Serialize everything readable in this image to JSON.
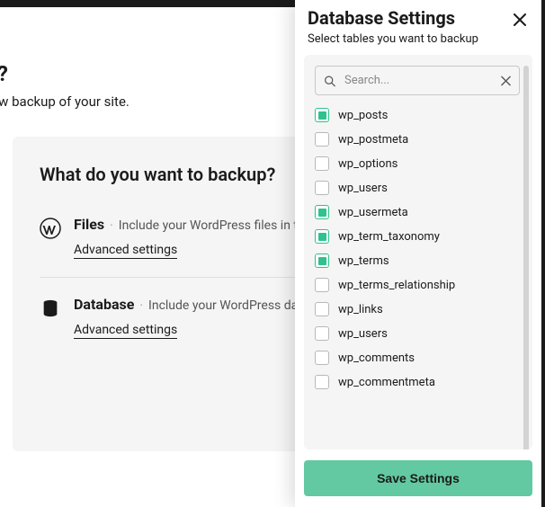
{
  "page": {
    "title_truncated": "up?",
    "subtitle_truncated": "a new backup of your site."
  },
  "backup": {
    "title": "What do you want to backup?",
    "files": {
      "label": "Files",
      "desc": "Include your WordPress files in the backup",
      "advanced": "Advanced settings"
    },
    "database": {
      "label": "Database",
      "desc": "Include your WordPress database",
      "advanced": "Advanced settings"
    }
  },
  "panel": {
    "title": "Database Settings",
    "subtitle": "Select tables you want to backup",
    "search_placeholder": "Search...",
    "save_label": "Save Settings",
    "tables": [
      {
        "name": "wp_posts",
        "checked": true
      },
      {
        "name": "wp_postmeta",
        "checked": false
      },
      {
        "name": "wp_options",
        "checked": false
      },
      {
        "name": "wp_users",
        "checked": false
      },
      {
        "name": "wp_usermeta",
        "checked": true
      },
      {
        "name": "wp_term_taxonomy",
        "checked": true
      },
      {
        "name": "wp_terms",
        "checked": true
      },
      {
        "name": "wp_terms_relationship",
        "checked": false
      },
      {
        "name": "wp_links",
        "checked": false
      },
      {
        "name": "wp_users",
        "checked": false
      },
      {
        "name": "wp_comments",
        "checked": false
      },
      {
        "name": "wp_commentmeta",
        "checked": false
      }
    ]
  }
}
